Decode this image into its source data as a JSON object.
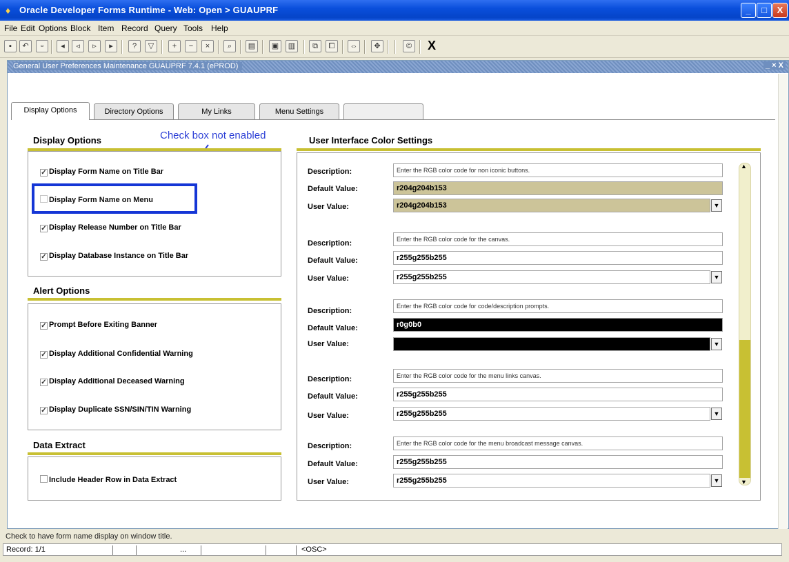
{
  "window": {
    "title": "Oracle Developer Forms Runtime - Web: Open > GUAUPRF",
    "minimize": "_",
    "maximize": "□",
    "close": "X"
  },
  "menu": [
    "File",
    "Edit",
    "Options",
    "Block",
    "Item",
    "Record",
    "Query",
    "Tools",
    "Help"
  ],
  "toolbar": {
    "exit_label": "X"
  },
  "inner_window": {
    "title": "General User Preferences Maintenance  GUAUPRF  7.4.1  (ePROD)",
    "controls": "_ × X"
  },
  "tabs": [
    {
      "label": "Display Options",
      "state": "active"
    },
    {
      "label": "Directory Options",
      "state": "normal"
    },
    {
      "label": "My Links",
      "state": "normal"
    },
    {
      "label": "Menu Settings",
      "state": "normal"
    },
    {
      "label": "",
      "state": "disabled"
    }
  ],
  "annotation": "Check box not enabled",
  "display_options": {
    "title": "Display Options",
    "items": [
      {
        "label": "Display Form Name on Title Bar",
        "checked": true
      },
      {
        "label": "Display Form Name on Menu",
        "checked": false
      },
      {
        "label": "Display Release Number on Title Bar",
        "checked": true
      },
      {
        "label": "Display Database Instance on Title Bar",
        "checked": true
      }
    ]
  },
  "alert_options": {
    "title": "Alert Options",
    "items": [
      {
        "label": "Prompt Before Exiting Banner",
        "checked": true
      },
      {
        "label": "Display Additional Confidential Warning",
        "checked": true
      },
      {
        "label": "Display Additional Deceased Warning",
        "checked": true
      },
      {
        "label": "Display Duplicate SSN/SIN/TIN Warning",
        "checked": true
      }
    ]
  },
  "data_extract": {
    "title": "Data Extract",
    "items": [
      {
        "label": "Include Header Row in Data Extract",
        "checked": false
      }
    ]
  },
  "color_settings": {
    "title": "User Interface Color Settings",
    "labels": {
      "description": "Description:",
      "default": "Default Value:",
      "user": "User Value:"
    },
    "groups": [
      {
        "description": "Enter the RGB color code for non iconic buttons.",
        "default": "r204g204b153",
        "user": "r204g204b153",
        "swatch": "#ccc499"
      },
      {
        "description": "Enter the RGB color code for the canvas.",
        "default": "r255g255b255",
        "user": "r255g255b255",
        "swatch": "#ffffff"
      },
      {
        "description": "Enter the RGB color code for code/description prompts.",
        "default": "r0g0b0",
        "user": "",
        "swatch": "#000000"
      },
      {
        "description": "Enter the RGB color code for the menu links canvas.",
        "default": "r255g255b255",
        "user": "r255g255b255",
        "swatch": "#ffffff"
      },
      {
        "description": "Enter the RGB color code for the menu broadcast message canvas.",
        "default": "r255g255b255",
        "user": "r255g255b255",
        "swatch": "#ffffff"
      }
    ]
  },
  "status": {
    "hint": "Check to have form name display on window title.",
    "record": "Record: 1/1",
    "ellipsis": "...",
    "mode": "<OSC>"
  },
  "colors": {
    "accent": "#c8c033",
    "annotation": "#1536d6",
    "titlebar": "#0a4fdc"
  }
}
